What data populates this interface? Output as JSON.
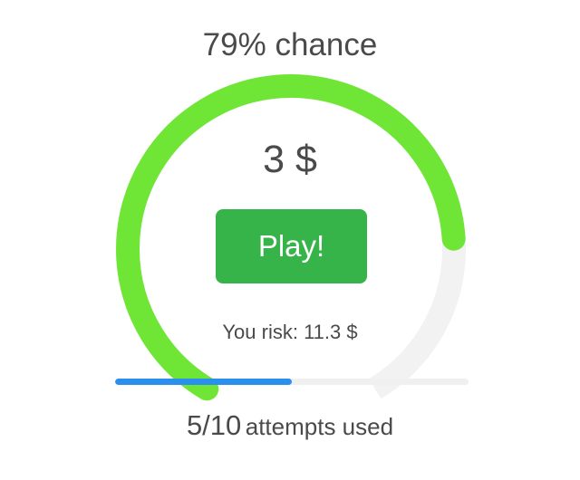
{
  "gauge": {
    "chance_text": "79% chance",
    "chance": 0.79,
    "prize_text": "3 $",
    "colors": {
      "fill": "#6fe635",
      "track": "#f2f2f2"
    }
  },
  "play_button": {
    "label": "Play!",
    "color": "#36b449"
  },
  "risk_text": "You risk: 11.3 $",
  "attempts": {
    "count_text": "5/10",
    "label": "attempts used",
    "used": 5,
    "total": 10,
    "fill_color": "#2b8fee",
    "track_color": "#f0f0f0"
  }
}
